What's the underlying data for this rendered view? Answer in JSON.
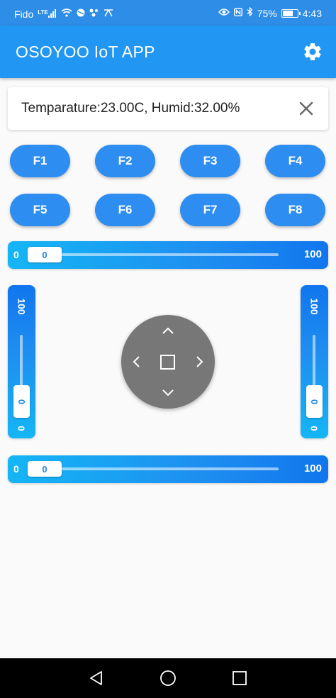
{
  "status_bar": {
    "carrier": "Fido",
    "network": "LTE",
    "battery": "75%",
    "battery_fraction": 0.75,
    "time": "4:43"
  },
  "app_bar": {
    "title": "OSOYOO IoT APP",
    "settings_icon": "gear-icon"
  },
  "info": {
    "text": "Temparature:23.00C, Humid:32.00%",
    "close_icon": "close-icon"
  },
  "function_buttons": [
    "F1",
    "F2",
    "F3",
    "F4",
    "F5",
    "F6",
    "F7",
    "F8"
  ],
  "sliders": {
    "top": {
      "min": "0",
      "max": "100",
      "value": "0"
    },
    "left": {
      "min": "0",
      "max": "100",
      "value": "0"
    },
    "right": {
      "min": "0",
      "max": "100",
      "value": "0"
    },
    "bottom": {
      "min": "0",
      "max": "100",
      "value": "0"
    }
  },
  "joystick": {
    "up_icon": "chevron-up-icon",
    "down_icon": "chevron-down-icon",
    "left_icon": "chevron-left-icon",
    "right_icon": "chevron-right-icon",
    "stop_icon": "square-stop-icon"
  },
  "colors": {
    "primary": "#2196f3",
    "status_bar": "#2e8de6",
    "button": "#2e8df0",
    "joystick": "#777777"
  },
  "nav": {
    "back_icon": "back-triangle-icon",
    "home_icon": "home-circle-icon",
    "recents_icon": "recents-square-icon"
  }
}
